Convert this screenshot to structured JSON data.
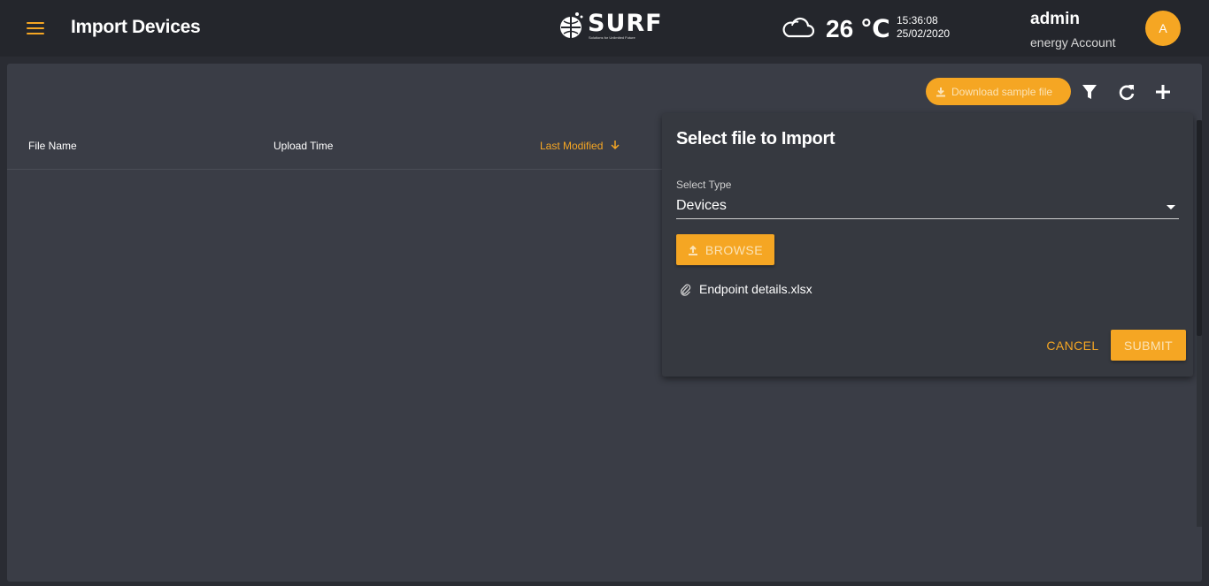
{
  "header": {
    "title": "Import Devices",
    "logo": {
      "text": "SURF",
      "tagline": "Solutions for Unlimited Future"
    },
    "weather": {
      "icon": "cloud-icon",
      "temperature": "26 ℃"
    },
    "time": "15:36:08",
    "date": "25/02/2020",
    "user": {
      "name": "admin",
      "account": "energy Account",
      "avatar_initial": "A"
    }
  },
  "toolbar": {
    "download_label": "Download sample file",
    "icons": [
      "filter-icon",
      "refresh-icon",
      "add-icon"
    ]
  },
  "table": {
    "columns": [
      {
        "label": "File Name"
      },
      {
        "label": "Upload Time"
      },
      {
        "label": "Last Modified",
        "sorted": "desc"
      }
    ],
    "rows": []
  },
  "import_panel": {
    "title": "Select file to Import",
    "select_label": "Select Type",
    "select_value": "Devices",
    "browse_label": "BROWSE",
    "selected_file": "Endpoint details.xlsx",
    "cancel_label": "CANCEL",
    "submit_label": "SUBMIT"
  },
  "colors": {
    "accent": "#f5a623",
    "header_bg": "#24262c",
    "card_bg": "#3a3d46",
    "panel_bg": "#363940"
  }
}
